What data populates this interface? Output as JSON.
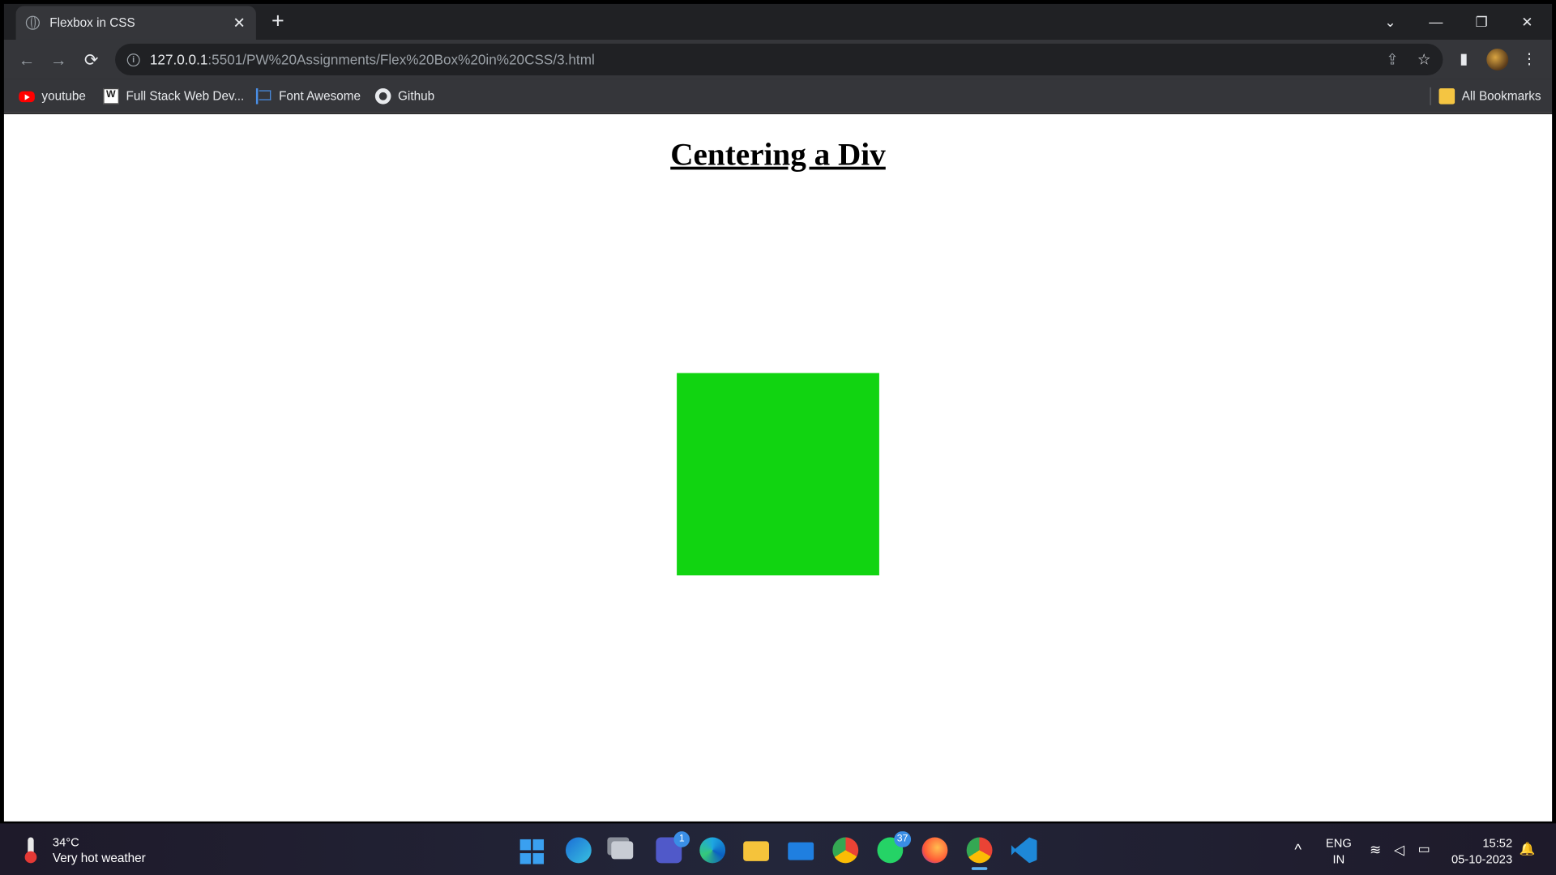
{
  "browser": {
    "tab": {
      "title": "Flexbox in CSS",
      "close": "✕"
    },
    "new_tab": "+",
    "window_controls": {
      "tabsearch": "⌄",
      "minimize": "—",
      "restore": "❐",
      "close": "✕"
    },
    "nav": {
      "back": "←",
      "forward": "→",
      "reload": "⟳"
    },
    "address": {
      "host": "127.0.0.1",
      "path": ":5501/PW%20Assignments/Flex%20Box%20in%20CSS/3.html"
    },
    "toolbar_icons": {
      "share": "⇪",
      "star": "☆",
      "sidepanel": "▮",
      "menu": "⋮"
    },
    "bookmarks": [
      {
        "label": "youtube",
        "icon": "youtube-icon"
      },
      {
        "label": "Full Stack Web Dev...",
        "icon": "fullstack-icon"
      },
      {
        "label": "Font Awesome",
        "icon": "flag-icon"
      },
      {
        "label": "Github",
        "icon": "github-icon"
      }
    ],
    "all_bookmarks": "All Bookmarks"
  },
  "page": {
    "heading": "Centering a Div",
    "box_color": "#11d411"
  },
  "taskbar": {
    "weather": {
      "temp": "34°C",
      "desc": "Very hot weather"
    },
    "apps": [
      {
        "name": "start",
        "badge": ""
      },
      {
        "name": "edge-beta",
        "badge": ""
      },
      {
        "name": "task-view",
        "badge": ""
      },
      {
        "name": "teams",
        "badge": "1"
      },
      {
        "name": "edge",
        "badge": ""
      },
      {
        "name": "file-explorer",
        "badge": ""
      },
      {
        "name": "mail",
        "badge": ""
      },
      {
        "name": "chrome",
        "badge": ""
      },
      {
        "name": "whatsapp",
        "badge": "37"
      },
      {
        "name": "firefox",
        "badge": ""
      },
      {
        "name": "chrome-profile",
        "badge": ""
      },
      {
        "name": "vscode",
        "badge": ""
      }
    ],
    "tray": {
      "chevron": "^",
      "lang_line1": "ENG",
      "lang_line2": "IN",
      "time": "15:52",
      "date": "05-10-2023"
    }
  }
}
